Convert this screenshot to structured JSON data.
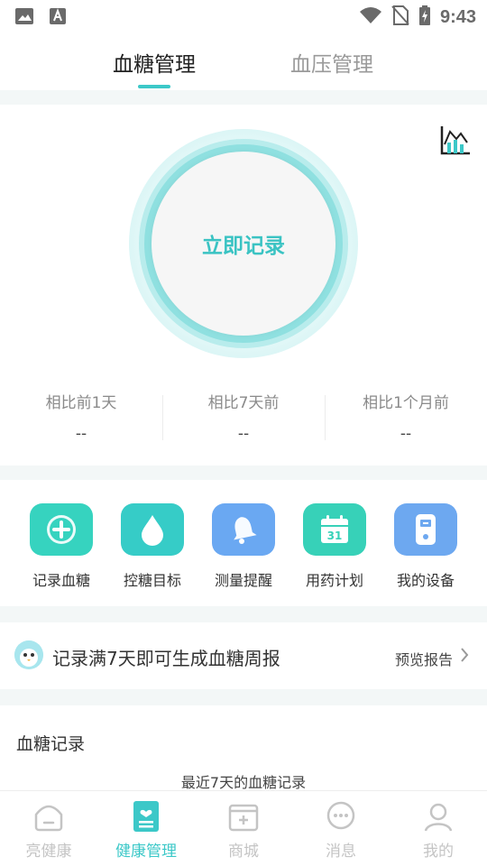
{
  "status_bar": {
    "time": "9:43"
  },
  "tabs": [
    {
      "label": "血糖管理"
    },
    {
      "label": "血压管理"
    }
  ],
  "record": {
    "button_label": "立即记录"
  },
  "compare": [
    {
      "label": "相比前1天",
      "value": "--"
    },
    {
      "label": "相比7天前",
      "value": "--"
    },
    {
      "label": "相比1个月前",
      "value": "--"
    }
  ],
  "shortcuts": [
    {
      "label": "记录血糖",
      "icon": "plus-circle-icon",
      "color": "#36d3bf"
    },
    {
      "label": "控糖目标",
      "icon": "drop-icon",
      "color": "#36ccc7"
    },
    {
      "label": "测量提醒",
      "icon": "bell-icon",
      "color": "#6aa8f2"
    },
    {
      "label": "用药计划",
      "icon": "calendar-icon",
      "color": "#37d1b8",
      "calendar_day": "31"
    },
    {
      "label": "我的设备",
      "icon": "device-icon",
      "color": "#6da8f0"
    }
  ],
  "banner": {
    "text": "记录满7天即可生成血糖周报",
    "link": "预览报告"
  },
  "records": {
    "title": "血糖记录",
    "subtitle": "最近7天的血糖记录"
  },
  "bottom_nav": [
    {
      "label": "亮健康",
      "icon": "home-icon"
    },
    {
      "label": "健康管理",
      "icon": "health-record-icon"
    },
    {
      "label": "商城",
      "icon": "shop-icon"
    },
    {
      "label": "消息",
      "icon": "message-icon"
    },
    {
      "label": "我的",
      "icon": "profile-icon"
    }
  ],
  "colors": {
    "accent": "#3cc8c8"
  }
}
